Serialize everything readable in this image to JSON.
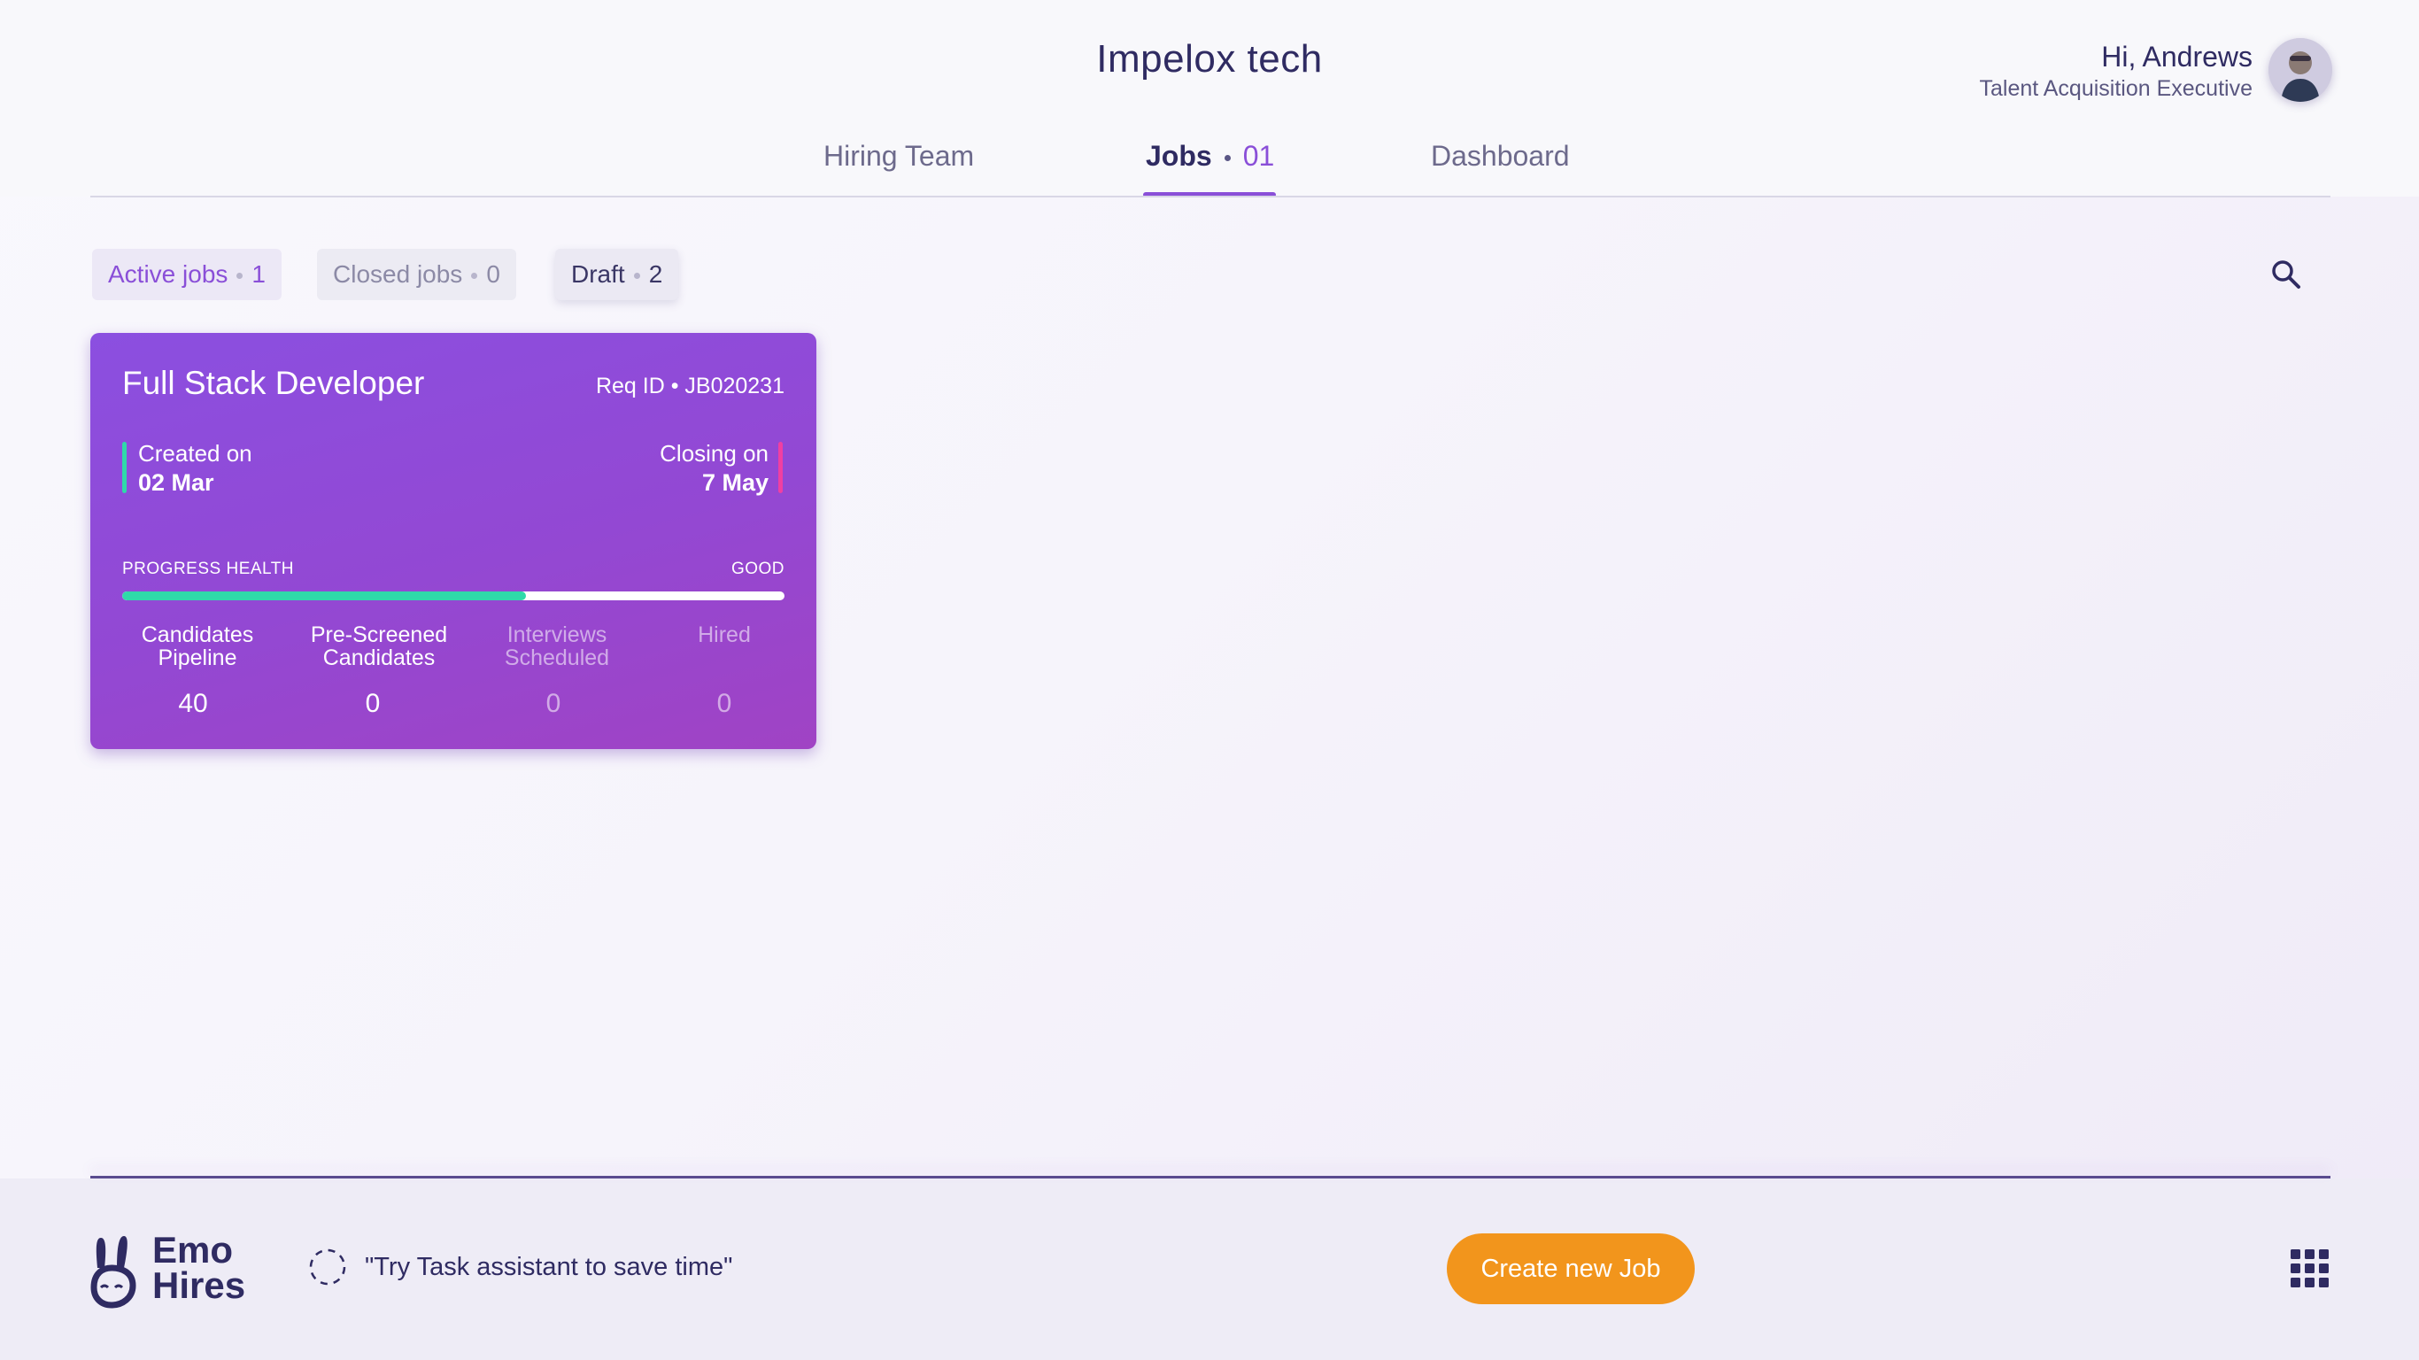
{
  "header": {
    "company_name": "Impelox tech",
    "user_greeting": "Hi, Andrews",
    "user_role": "Talent Acquisition Executive",
    "avatar_icon": "user-avatar"
  },
  "tabs": [
    {
      "label": "Hiring Team"
    },
    {
      "label": "Jobs",
      "count": "01",
      "active": true
    },
    {
      "label": "Dashboard"
    }
  ],
  "filters": [
    {
      "label": "Active jobs",
      "count": "1",
      "active": true
    },
    {
      "label": "Closed jobs",
      "count": "0"
    },
    {
      "label": "Draft",
      "count": "2"
    }
  ],
  "search_icon": "search-icon",
  "job_card": {
    "title": "Full Stack Developer",
    "req_id": "Req ID • JB020231",
    "created_label": "Created on",
    "created_value": "02 Mar",
    "closing_label": "Closing on",
    "closing_value": "7 May",
    "progress_label": "PROGRESS HEALTH",
    "progress_status": "GOOD",
    "progress_fraction": 0.61,
    "stats": [
      {
        "label_line1": "Candidates",
        "label_line2": "Pipeline",
        "value": "40"
      },
      {
        "label_line1": "Pre-Screened",
        "label_line2": "Candidates",
        "value": "0"
      },
      {
        "label_line1": "Interviews",
        "label_line2": "Scheduled",
        "value": "0"
      },
      {
        "label_line1": "Hired",
        "label_line2": "",
        "value": "0"
      }
    ]
  },
  "footer": {
    "logo_line1": "Emo",
    "logo_line2": "Hires",
    "assistant_text": "\"Try Task assistant to save time\"",
    "create_button": "Create new Job",
    "apps_icon": "grid-apps-icon"
  },
  "colors": {
    "accent": "#8a4fd8",
    "progress_good": "#2fd9a9",
    "closing_marker": "#f03fa2",
    "primary_button": "#f2951c",
    "text_dark": "#2f2b62"
  }
}
